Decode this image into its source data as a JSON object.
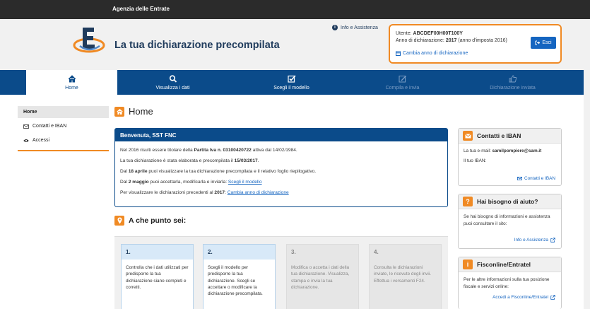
{
  "topbar": {
    "title": "Agenzia delle Entrate"
  },
  "header": {
    "app_title": "La tua dichiarazione precompilata",
    "info_link": "Info e Assistenza",
    "user_label": "Utente:",
    "user_code": "ABCDEF00H00T100Y",
    "year_label": "Anno di dichiarazione:",
    "year_value": "2017",
    "year_note": "(anno d'imposta 2016)",
    "change_year": "Cambia anno di dichiarazione",
    "logout": "Esci"
  },
  "nav": [
    {
      "label": "Home",
      "icon": "home-icon"
    },
    {
      "label": "Visualizza i dati",
      "icon": "search-icon"
    },
    {
      "label": "Scegli il modello",
      "icon": "checkbox-icon"
    },
    {
      "label": "Compila e invia",
      "icon": "edit-icon"
    },
    {
      "label": "Dichiarazione inviata",
      "icon": "thumbs-up-icon"
    }
  ],
  "sidebar": [
    {
      "label": "Home",
      "icon": ""
    },
    {
      "label": "Contatti e IBAN",
      "icon": "envelope-icon"
    },
    {
      "label": "Accessi",
      "icon": "eye-icon"
    }
  ],
  "main": {
    "title": "Home",
    "welcome": {
      "title": "Benvenuta, SST FNC",
      "p1_a": "Nel 2016 risulti essere titolare della",
      "p1_b": "Partita Iva n. 03100420722",
      "p1_c": "attiva dal 14/02/1984.",
      "p2_a": "La tua dichiarazione è stata elaborata e precompilata il",
      "p2_b": "15/03/2017",
      "p2_c": ".",
      "p3_a": "Dal",
      "p3_b": "18 aprile",
      "p3_c": "puoi visualizzare la tua dichiarazione precompilata e il relativo foglio riepilogativo.",
      "p4_a": "Dal",
      "p4_b": "2 maggio",
      "p4_c": "puoi accettarla, modificarla e inviarla:",
      "p4_link": "Scegli il modello",
      "p5_a": "Per visualizzare le dichiarazioni precedenti al",
      "p5_b": "2017",
      "p5_c": ":",
      "p5_link": "Cambia anno di dichiarazione"
    },
    "steps_title": "A che punto sei:",
    "steps": [
      {
        "num": "1.",
        "text": "Controlla che i dati utilizzati per predisporre la tua dichiarazione siano completi e corretti."
      },
      {
        "num": "2.",
        "text": "Scegli il modello per predisporre la tua dichiarazione. Scegli se accettare o modificare la dichiarazione precompilata."
      },
      {
        "num": "3.",
        "text": "Modifica o accetta i dati della tua dichiarazione. Visualizza, stampa e invia la tua dichiarazione."
      },
      {
        "num": "4.",
        "text": "Consulta le dichiarazioni inviate, le ricevute degli invii. Effettua i versamenti F24."
      }
    ]
  },
  "panels": {
    "contacts": {
      "title": "Contatti e IBAN",
      "email_label": "La tua e-mail:",
      "email": "samilpompiere@sam.it",
      "iban_label": "Il tuo IBAN:",
      "action": "Contatti e IBAN"
    },
    "help": {
      "title": "Hai bisogno di aiuto?",
      "text": "Se hai bisogno di informazioni e assistenza puoi consultare il sito:",
      "action": "Info e Assistenza"
    },
    "fisco": {
      "title": "Fisconline/Entratel",
      "text": "Per le altre informazioni sulla tua posizione fiscale e servizi online:",
      "action": "Accedi a Fisconline/Entratel"
    }
  },
  "colors": {
    "nav": "#0b4b8a",
    "accent": "#f08a24",
    "link": "#1565c0"
  }
}
